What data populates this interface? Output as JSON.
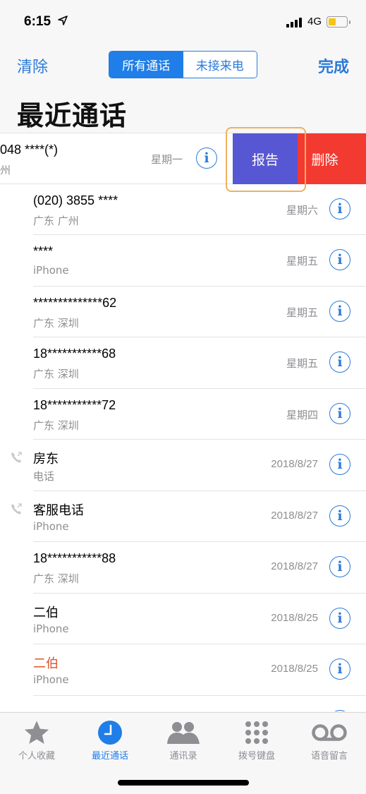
{
  "status_bar": {
    "time": "6:15",
    "network": "4G",
    "battery_level": 0.4
  },
  "nav": {
    "left_button": "清除",
    "right_button": "完成",
    "segments": [
      "所有通话",
      "未接来电"
    ],
    "selected_segment": 0
  },
  "title": "最近通话",
  "swiped_row": {
    "name": "048 ****(*)",
    "sub": "州",
    "when": "星期一",
    "actions": {
      "report": "报告",
      "delete": "删除"
    }
  },
  "calls": [
    {
      "name": "(020) 3855 ****",
      "sub": "广东 广州",
      "when": "星期六",
      "missed": false,
      "outgoing_icon": false
    },
    {
      "name": "****",
      "sub": "iPhone",
      "when": "星期五",
      "missed": false,
      "outgoing_icon": false
    },
    {
      "name": "**************62",
      "sub": "广东 深圳",
      "when": "星期五",
      "missed": false,
      "outgoing_icon": false
    },
    {
      "name": "18***********68",
      "sub": "广东 深圳",
      "when": "星期五",
      "missed": false,
      "outgoing_icon": false
    },
    {
      "name": "18***********72",
      "sub": "广东 深圳",
      "when": "星期四",
      "missed": false,
      "outgoing_icon": false
    },
    {
      "name": "房东",
      "sub": "电话",
      "when": "2018/8/27",
      "missed": false,
      "outgoing_icon": true
    },
    {
      "name": "客服电话",
      "sub": "iPhone",
      "when": "2018/8/27",
      "missed": false,
      "outgoing_icon": true
    },
    {
      "name": "18***********88",
      "sub": "广东 深圳",
      "when": "2018/8/27",
      "missed": false,
      "outgoing_icon": false
    },
    {
      "name": "二伯",
      "sub": "iPhone",
      "when": "2018/8/25",
      "missed": false,
      "outgoing_icon": false
    },
    {
      "name": "二伯",
      "sub": "iPhone",
      "when": "2018/8/25",
      "missed": true,
      "outgoing_icon": false
    },
    {
      "name": "",
      "sub": "",
      "when": "",
      "missed": false,
      "outgoing_icon": false
    }
  ],
  "tabs": [
    {
      "label": "个人收藏",
      "icon": "star-icon",
      "active": false
    },
    {
      "label": "最近通话",
      "icon": "clock-icon",
      "active": true
    },
    {
      "label": "通讯录",
      "icon": "contacts-icon",
      "active": false
    },
    {
      "label": "拨号键盘",
      "icon": "keypad-icon",
      "active": false
    },
    {
      "label": "语音留言",
      "icon": "voicemail-icon",
      "active": false
    }
  ],
  "colors": {
    "accent": "#1f7ee8",
    "missed": "#d9542c",
    "report": "#5857d3",
    "delete": "#f33a30"
  }
}
